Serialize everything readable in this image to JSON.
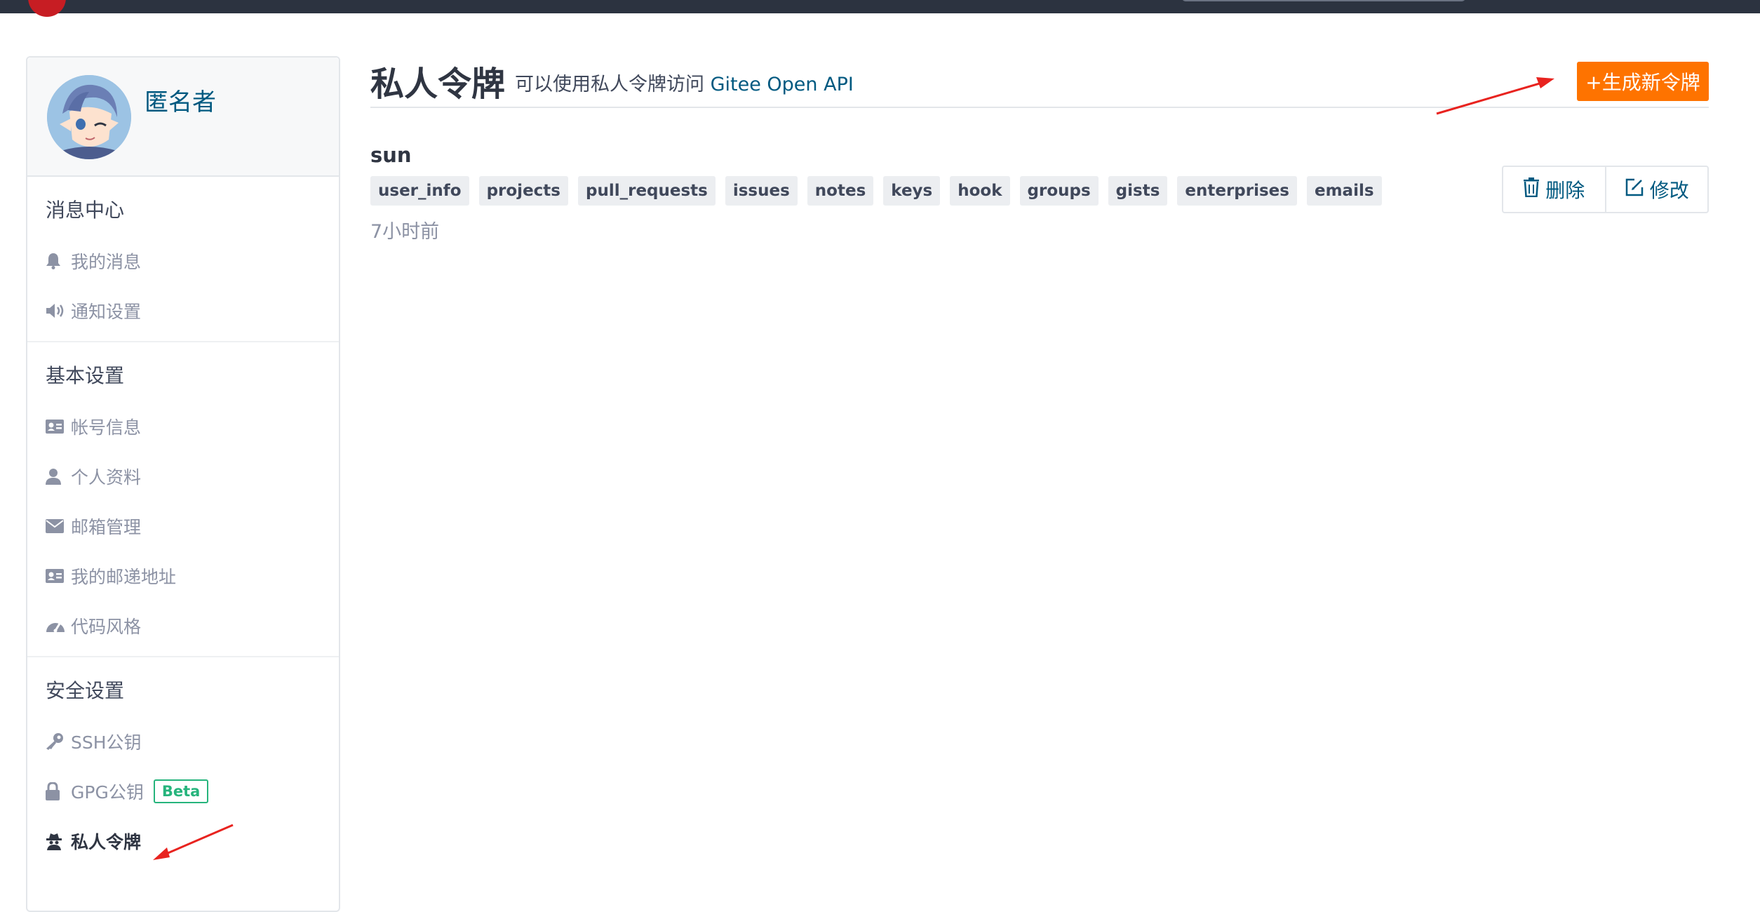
{
  "profile": {
    "username": "匿名者"
  },
  "sidebar": {
    "sections": [
      {
        "title": "消息中心",
        "items": [
          {
            "label": "我的消息",
            "icon": "bell-icon"
          },
          {
            "label": "通知设置",
            "icon": "volume-icon"
          }
        ]
      },
      {
        "title": "基本设置",
        "items": [
          {
            "label": "帐号信息",
            "icon": "id-card-icon"
          },
          {
            "label": "个人资料",
            "icon": "user-icon"
          },
          {
            "label": "邮箱管理",
            "icon": "envelope-icon"
          },
          {
            "label": "我的邮递地址",
            "icon": "address-card-icon"
          },
          {
            "label": "代码风格",
            "icon": "dashboard-icon"
          }
        ]
      },
      {
        "title": "安全设置",
        "items": [
          {
            "label": "SSH公钥",
            "icon": "key-icon"
          },
          {
            "label": "GPG公钥",
            "icon": "lock-icon",
            "badge": "Beta"
          },
          {
            "label": "私人令牌",
            "icon": "spy-icon",
            "active": true
          }
        ]
      }
    ]
  },
  "header": {
    "title": "私人令牌",
    "description": "可以使用私人令牌访问",
    "link_text": "Gitee Open API",
    "new_token_label": "+生成新令牌"
  },
  "token": {
    "name": "sun",
    "scopes": [
      "user_info",
      "projects",
      "pull_requests",
      "issues",
      "notes",
      "keys",
      "hook",
      "groups",
      "gists",
      "enterprises",
      "emails"
    ],
    "time": "7小时前",
    "delete_label": "删除",
    "edit_label": "修改"
  },
  "colors": {
    "accent": "#fe7300",
    "link": "#005980",
    "beta": "#26b47c",
    "annotation_arrow": "#e8231f"
  }
}
